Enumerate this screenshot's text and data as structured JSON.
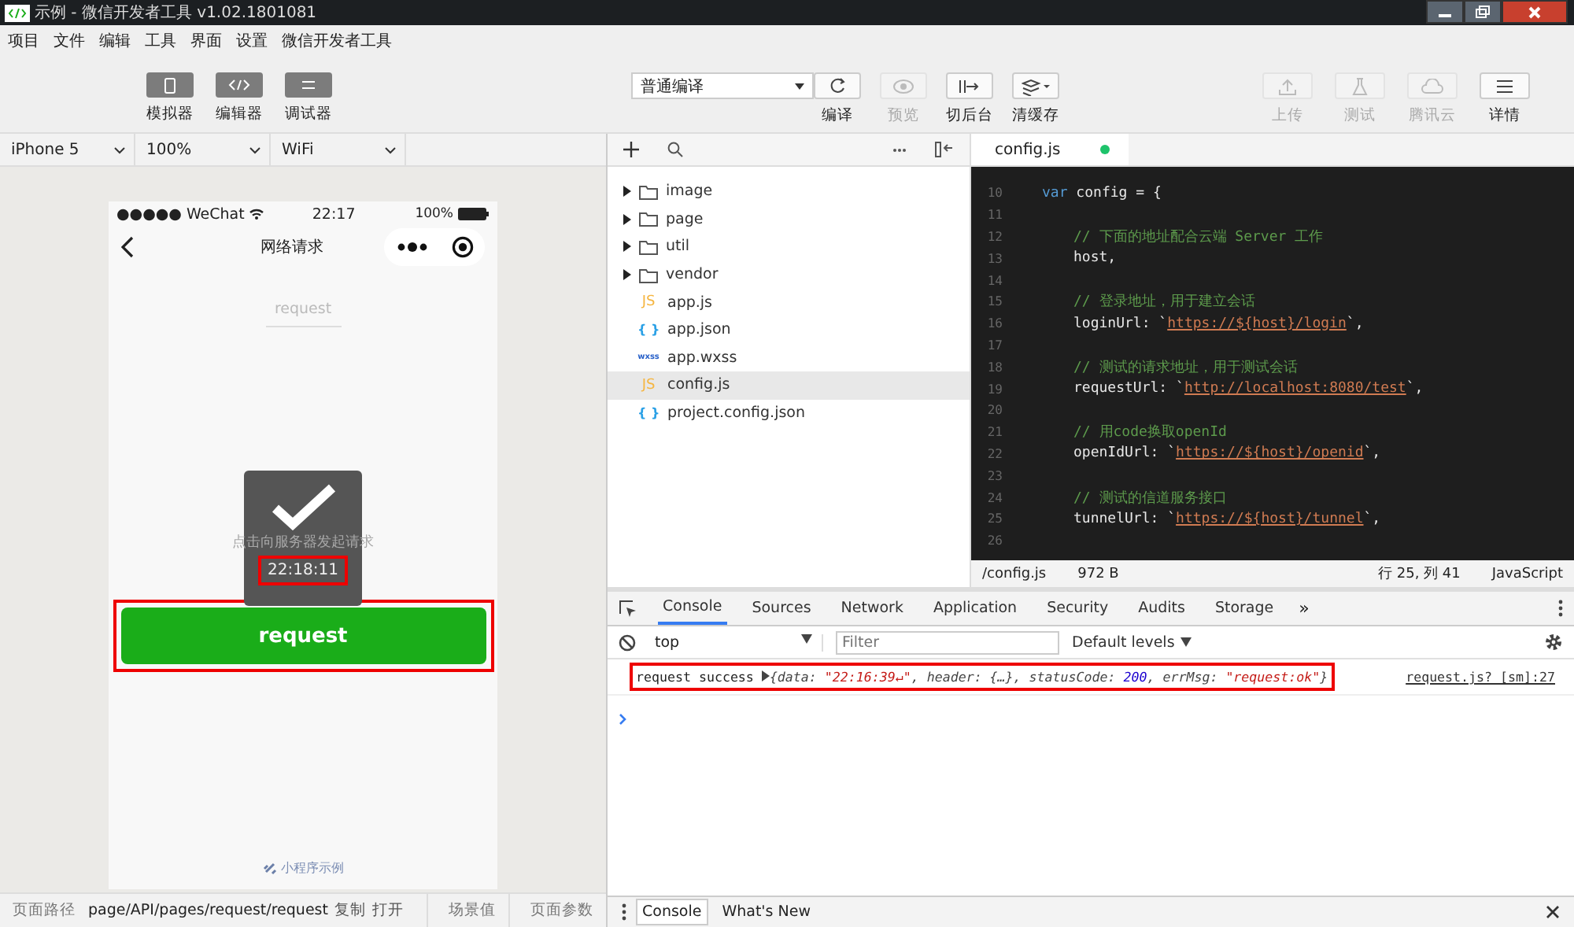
{
  "window": {
    "title": "示例 - 微信开发者工具 v1.02.1801081"
  },
  "menu": [
    "项目",
    "文件",
    "编辑",
    "工具",
    "界面",
    "设置",
    "微信开发者工具"
  ],
  "view_toggles": [
    {
      "label": "模拟器",
      "selected": true
    },
    {
      "label": "编辑器",
      "selected": true
    },
    {
      "label": "调试器",
      "selected": true
    }
  ],
  "compile_mode": "普通编译",
  "tools": [
    {
      "label": "编译",
      "disabled": false
    },
    {
      "label": "预览",
      "disabled": true
    },
    {
      "label": "切后台",
      "disabled": false
    },
    {
      "label": "清缓存",
      "disabled": false
    }
  ],
  "publish_tools": [
    {
      "label": "上传",
      "disabled": true
    },
    {
      "label": "测试",
      "disabled": true
    },
    {
      "label": "腾讯云",
      "disabled": true
    },
    {
      "label": "详情",
      "disabled": false
    }
  ],
  "device_selects": [
    "iPhone 5",
    "100%",
    "WiFi"
  ],
  "phone": {
    "carrier": "●●●●● WeChat",
    "time": "22:17",
    "battery": "100%",
    "title": "网络请求",
    "input_placeholder": "request",
    "hint": "点击向服务器发起请求",
    "toast": {
      "text": "22:18:11",
      "highlighted": true
    },
    "button": {
      "label": "request",
      "highlighted": true
    },
    "footer": "小程序示例"
  },
  "page_bar": {
    "label": "页面路径",
    "path": "page/API/pages/request/request",
    "actions": [
      "复制",
      "打开"
    ],
    "scene": "场景值",
    "params": "页面参数"
  },
  "files": [
    {
      "name": "image",
      "kind": "folder",
      "selected": false
    },
    {
      "name": "page",
      "kind": "folder",
      "selected": false
    },
    {
      "name": "util",
      "kind": "folder",
      "selected": false
    },
    {
      "name": "vendor",
      "kind": "folder",
      "selected": false
    },
    {
      "name": "app.js",
      "kind": "js",
      "badge": "JS",
      "selected": false
    },
    {
      "name": "app.json",
      "kind": "json",
      "badge": "{ }",
      "selected": false
    },
    {
      "name": "app.wxss",
      "kind": "wxss",
      "badge": "wxss",
      "selected": false
    },
    {
      "name": "config.js",
      "kind": "js",
      "badge": "JS",
      "selected": true
    },
    {
      "name": "project.config.json",
      "kind": "json",
      "badge": "{ }",
      "selected": false
    }
  ],
  "editor": {
    "tab": "config.js",
    "saved": true,
    "lines": [
      {
        "number": "10",
        "segments": [
          {
            "kind": "keyword",
            "text": "var"
          },
          {
            "kind": "plain",
            "text": " config = {"
          }
        ]
      },
      {
        "number": "11"
      },
      {
        "number": "12",
        "segments": [
          {
            "kind": "comment",
            "text": "// 下面的地址配合云端 Server 工作"
          }
        ]
      },
      {
        "number": "13",
        "segments": [
          {
            "kind": "plain",
            "text": "host,"
          }
        ]
      },
      {
        "number": "14"
      },
      {
        "number": "15",
        "segments": [
          {
            "kind": "comment",
            "text": "// 登录地址，用于建立会话"
          }
        ]
      },
      {
        "number": "16",
        "segments": [
          {
            "kind": "plain",
            "text": "loginUrl: `"
          },
          {
            "kind": "string",
            "text": "https://${host}/login"
          },
          {
            "kind": "plain",
            "text": "`,"
          }
        ]
      },
      {
        "number": "17"
      },
      {
        "number": "18",
        "segments": [
          {
            "kind": "comment",
            "text": "// 测试的请求地址，用于测试会话"
          }
        ]
      },
      {
        "number": "19",
        "segments": [
          {
            "kind": "plain",
            "text": "requestUrl: `"
          },
          {
            "kind": "string",
            "text": "http://localhost:8080/test"
          },
          {
            "kind": "plain",
            "text": "`,"
          }
        ]
      },
      {
        "number": "20"
      },
      {
        "number": "21",
        "segments": [
          {
            "kind": "comment",
            "text": "// 用code换取openId"
          }
        ]
      },
      {
        "number": "22",
        "segments": [
          {
            "kind": "plain",
            "text": "openIdUrl: `"
          },
          {
            "kind": "string",
            "text": "https://${host}/openid"
          },
          {
            "kind": "plain",
            "text": "`,"
          }
        ]
      },
      {
        "number": "23"
      },
      {
        "number": "24",
        "segments": [
          {
            "kind": "comment",
            "text": "// 测试的信道服务接口"
          }
        ]
      },
      {
        "number": "25",
        "segments": [
          {
            "kind": "plain",
            "text": "tunnelUrl: `"
          },
          {
            "kind": "string",
            "text": "https://${host}/tunnel"
          },
          {
            "kind": "plain",
            "text": "`,"
          }
        ]
      },
      {
        "number": "26"
      }
    ],
    "status": {
      "path": "/config.js",
      "size": "972 B",
      "position": "行 25, 列 41",
      "language": "JavaScript"
    }
  },
  "devtools": {
    "tabs": [
      {
        "label": "Console",
        "selected": true
      },
      {
        "label": "Sources",
        "selected": false
      },
      {
        "label": "Network",
        "selected": false
      },
      {
        "label": "Application",
        "selected": false
      },
      {
        "label": "Security",
        "selected": false
      },
      {
        "label": "Audits",
        "selected": false
      },
      {
        "label": "Storage",
        "selected": false
      }
    ],
    "more": "»",
    "context": "top",
    "filter_placeholder": "Filter",
    "levels": "Default levels",
    "log": {
      "message": "request success",
      "object": [
        {
          "kind": "key",
          "text": "{data: "
        },
        {
          "kind": "string",
          "text": "\"22:16:39↵\""
        },
        {
          "kind": "key",
          "text": ", header: {…}, statusCode: "
        },
        {
          "kind": "number",
          "text": "200"
        },
        {
          "kind": "key",
          "text": ", errMsg: "
        },
        {
          "kind": "string",
          "text": "\"request:ok\""
        },
        {
          "kind": "key",
          "text": "}"
        }
      ],
      "source": "request.js? [sm]:27",
      "highlighted": true
    },
    "drawer_tabs": [
      {
        "label": "Console",
        "selected": true
      },
      {
        "label": "What's New",
        "selected": false
      }
    ]
  }
}
